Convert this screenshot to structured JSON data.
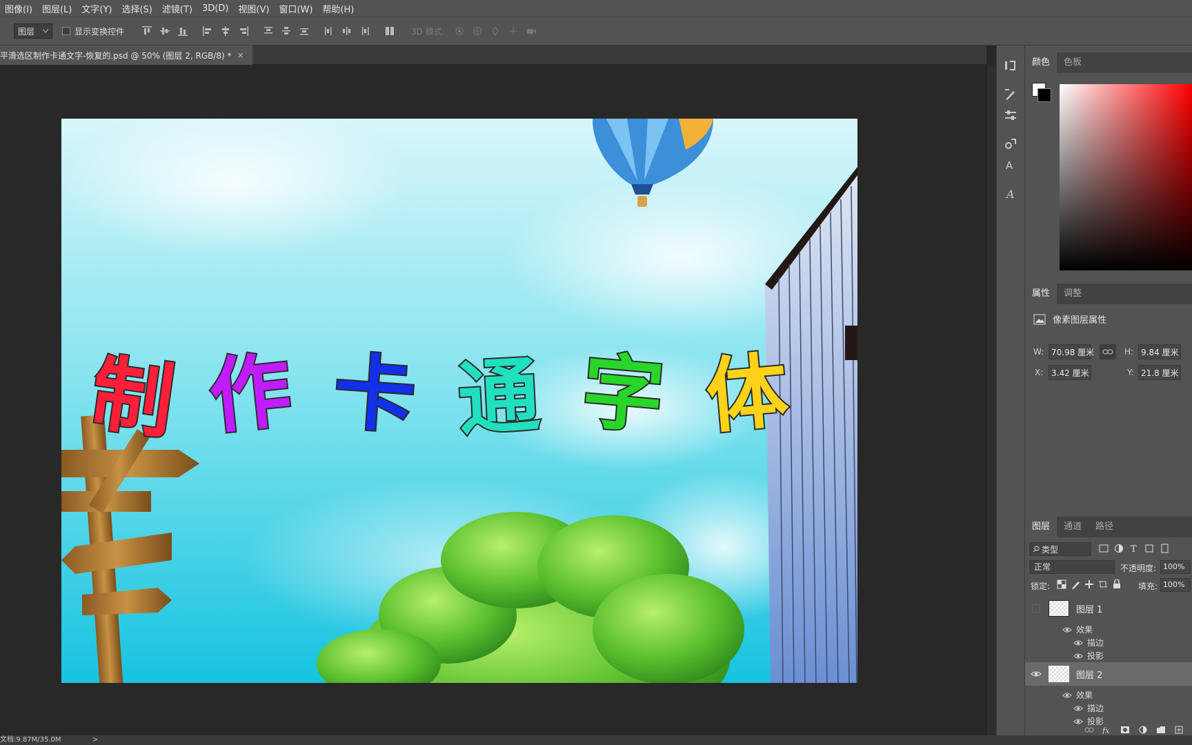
{
  "menu": [
    "图像(I)",
    "图层(L)",
    "文字(Y)",
    "选择(S)",
    "滤镜(T)",
    "3D(D)",
    "视图(V)",
    "窗口(W)",
    "帮助(H)"
  ],
  "options": {
    "auto_select_value": "图层",
    "show_transform_label": "显示变换控件",
    "mode_3d_label": "3D 模式:"
  },
  "document": {
    "tab_title": "平滑选区制作卡通文字-恢复的.psd @ 50% (图层 2, RGB/8) *",
    "close_glyph": "×"
  },
  "canvas": {
    "headline_chars": [
      "制",
      "作",
      "卡",
      "通",
      "字",
      "体"
    ],
    "headline_colors": [
      "#ff1f3a",
      "#c11cff",
      "#1130e8",
      "#20e0c0",
      "#28d62a",
      "#ffd21a"
    ]
  },
  "panels": {
    "color_tabs": [
      "颜色",
      "色板"
    ],
    "properties_tabs": [
      "属性",
      "调整"
    ],
    "properties_title": "像素图层属性",
    "props": {
      "w_label": "W:",
      "w_value": "70.98 厘米",
      "h_label": "H:",
      "h_value": "9.84 厘米",
      "x_label": "X:",
      "x_value": "3.42 厘米",
      "y_label": "Y:",
      "y_value": "21.8 厘米"
    },
    "layers_tabs": [
      "图层",
      "通道",
      "路径"
    ],
    "filter_label": "类型",
    "blend_mode": "正常",
    "opacity_label": "不透明度:",
    "opacity_value": "100%",
    "lock_label": "锁定:",
    "fill_label": "填充:",
    "fill_value": "100%",
    "layers": [
      {
        "name": "图层 1",
        "effects_label": "效果",
        "effects": [
          "描边",
          "投影"
        ]
      },
      {
        "name": "图层 2",
        "effects_label": "效果",
        "effects": [
          "描边",
          "投影"
        ]
      }
    ]
  },
  "status": {
    "doc_size": "文档:9.87M/35.0M",
    "arrow": ">"
  }
}
